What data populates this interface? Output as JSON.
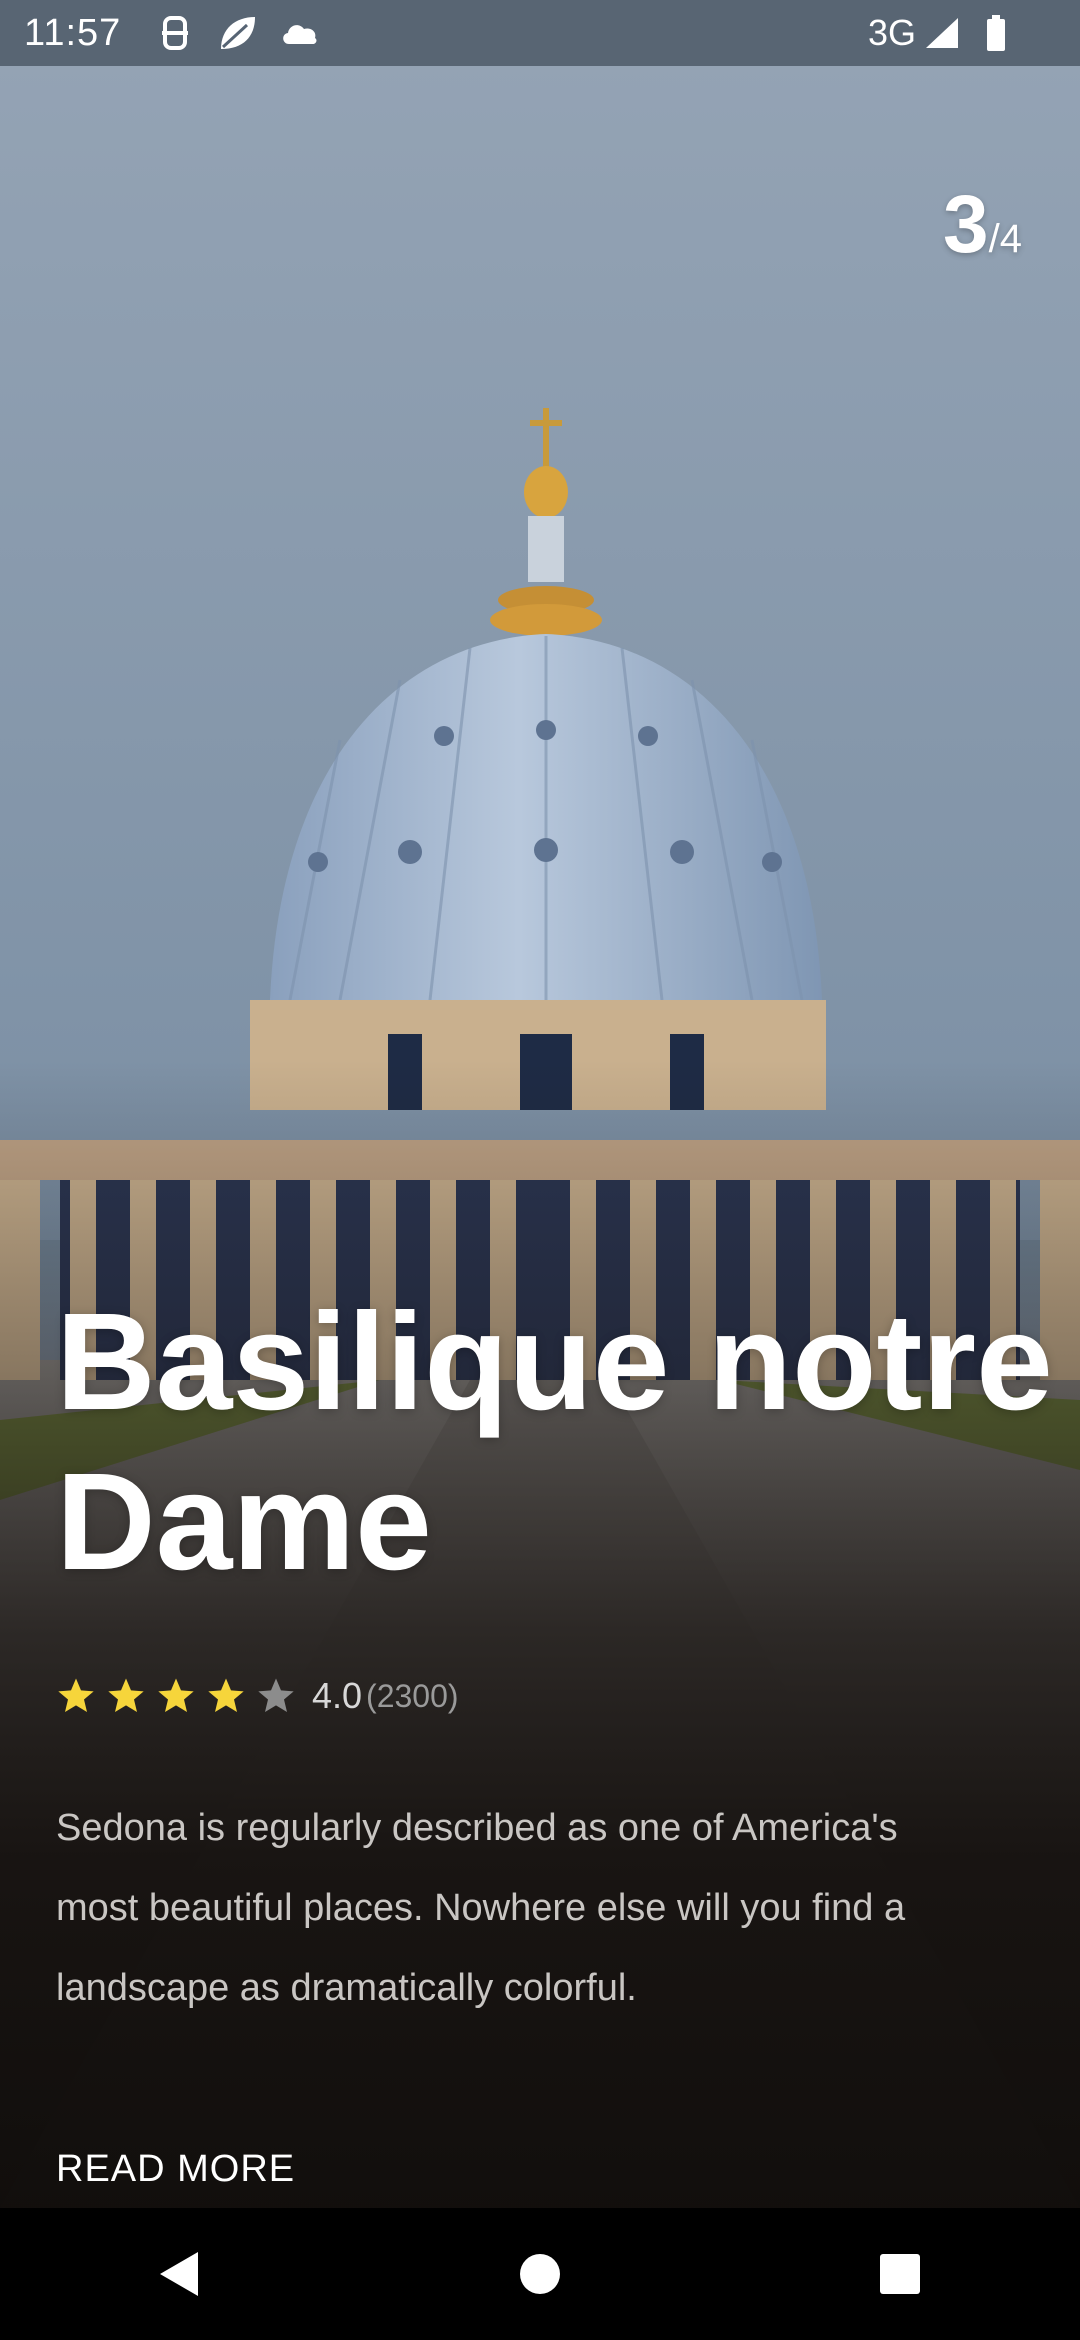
{
  "status_bar": {
    "time": "11:57",
    "network": "3G",
    "icons": [
      "vpn-icon",
      "leaf-icon",
      "cloud-icon",
      "signal-icon",
      "battery-icon"
    ]
  },
  "counter": {
    "current": "3",
    "total": "/4"
  },
  "place": {
    "title": "Basilique notre Dame",
    "rating_value": "4.0",
    "rating_count": "(2300)",
    "rating": 4,
    "max_rating": 5,
    "description": "Sedona is regularly described as one of America's most beautiful places. Nowhere else will you find a landscape as dramatically colorful.",
    "read_more": "READ MORE"
  },
  "colors": {
    "star_filled": "#f6d53b",
    "star_empty": "#8c8c8c",
    "sky": "#8f9fb1",
    "dome": "#a9bbd2",
    "stone": "#c4ab8c"
  },
  "nav": {
    "buttons": [
      "back-icon",
      "home-icon",
      "recents-icon"
    ]
  }
}
